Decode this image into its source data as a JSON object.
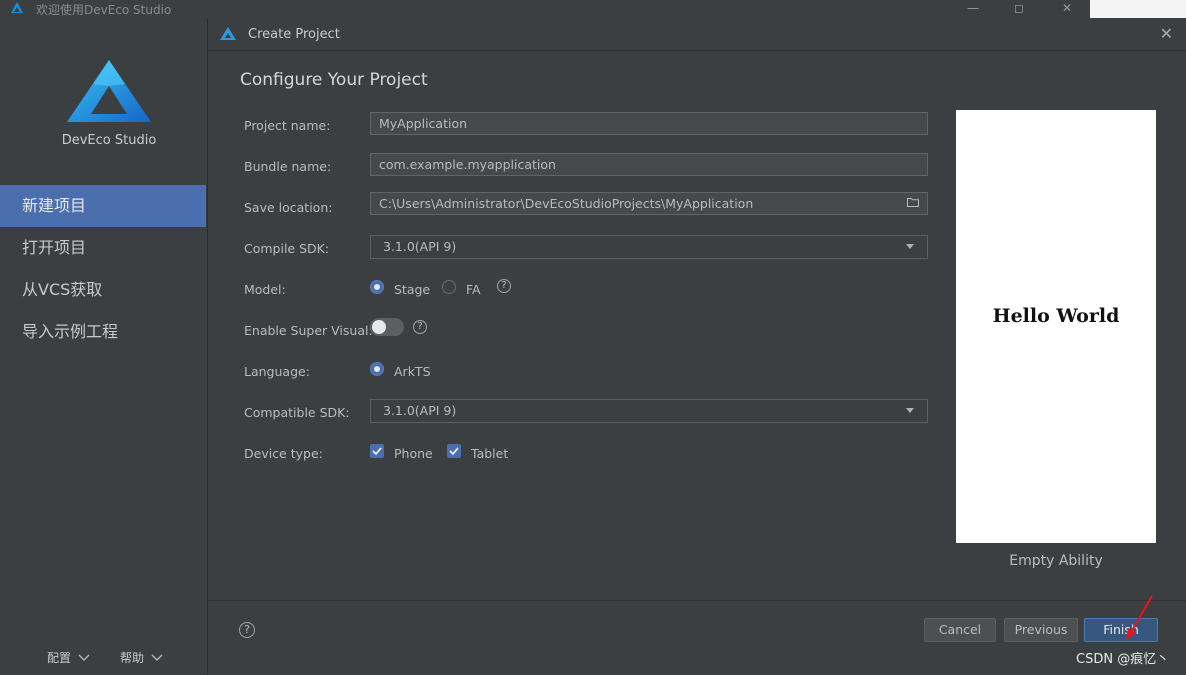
{
  "window": {
    "title": "欢迎使用DevEco Studio",
    "controls": [
      "minimize",
      "maximize",
      "close"
    ]
  },
  "sidebar": {
    "brand": "DevEco Studio",
    "items": [
      {
        "label": "新建项目",
        "active": true
      },
      {
        "label": "打开项目",
        "active": false
      },
      {
        "label": "从VCS获取",
        "active": false
      },
      {
        "label": "导入示例工程",
        "active": false
      }
    ],
    "footer": {
      "config": "配置",
      "help": "帮助"
    }
  },
  "dialog": {
    "title": "Create Project",
    "heading": "Configure Your Project",
    "fields": {
      "project_name": {
        "label": "Project name:",
        "value": "MyApplication"
      },
      "bundle_name": {
        "label": "Bundle name:",
        "value": "com.example.myapplication"
      },
      "save_location": {
        "label": "Save location:",
        "value": "C:\\Users\\Administrator\\DevEcoStudioProjects\\MyApplication"
      },
      "compile_sdk": {
        "label": "Compile SDK:",
        "value": "3.1.0(API 9)"
      },
      "model": {
        "label": "Model:",
        "options": [
          "Stage",
          "FA"
        ],
        "selected": "Stage"
      },
      "super_visual": {
        "label": "Enable Super Visual:",
        "enabled": false
      },
      "language": {
        "label": "Language:",
        "value": "ArkTS"
      },
      "compatible_sdk": {
        "label": "Compatible SDK:",
        "value": "3.1.0(API 9)"
      },
      "device_type": {
        "label": "Device type:",
        "options": [
          "Phone",
          "Tablet"
        ],
        "checked": [
          "Phone",
          "Tablet"
        ]
      }
    },
    "preview": {
      "text": "Hello World",
      "caption": "Empty Ability"
    },
    "buttons": {
      "cancel": "Cancel",
      "previous": "Previous",
      "finish": "Finish"
    },
    "help_symbol": "?"
  },
  "watermark": "CSDN @痕忆丶",
  "colors": {
    "accent": "#4b6eaf",
    "background": "#3c3f41",
    "annotation": "#e8141a"
  }
}
